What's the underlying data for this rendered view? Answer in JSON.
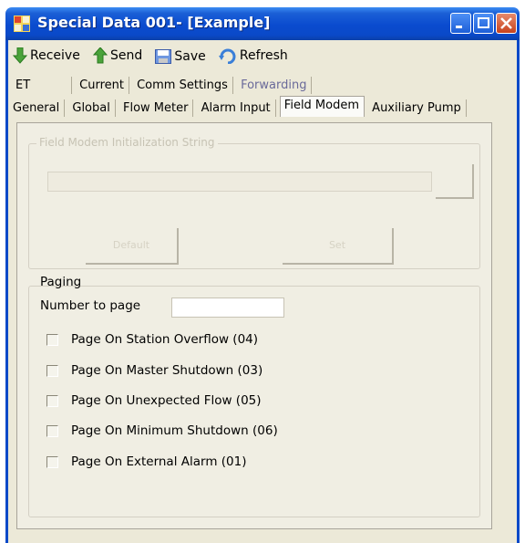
{
  "window": {
    "title": "Special Data 001- [Example]"
  },
  "toolbar": {
    "receive_label": "Receive",
    "send_label": "Send",
    "save_label": "Save",
    "refresh_label": "Refresh"
  },
  "tabs": {
    "row1": [
      "ET",
      "Current",
      "Comm Settings",
      "Forwarding"
    ],
    "row2": [
      "General",
      "Global",
      "Flow Meter",
      "Alarm Input",
      "Field Modem",
      "Auxiliary Pump"
    ],
    "active": "Field Modem"
  },
  "field_modem": {
    "group_label": "Field Modem Initialization String",
    "button_left_label": "Default",
    "button_right_label": "Set"
  },
  "paging": {
    "group_label": "Paging",
    "number_label": "Number to page",
    "number_value": "",
    "checkboxes": [
      {
        "label": "Page On Station Overflow (04)",
        "checked": false
      },
      {
        "label": "Page On Master Shutdown (03)",
        "checked": false
      },
      {
        "label": "Page On Unexpected Flow (05)",
        "checked": false
      },
      {
        "label": "Page On Minimum Shutdown (06)",
        "checked": false
      },
      {
        "label": "Page On External Alarm (01)",
        "checked": false
      }
    ]
  },
  "colors": {
    "titlebar": "#0a49c8",
    "frame": "#ece9d8",
    "panel": "#f0eee3",
    "close_button": "#c8431d"
  }
}
